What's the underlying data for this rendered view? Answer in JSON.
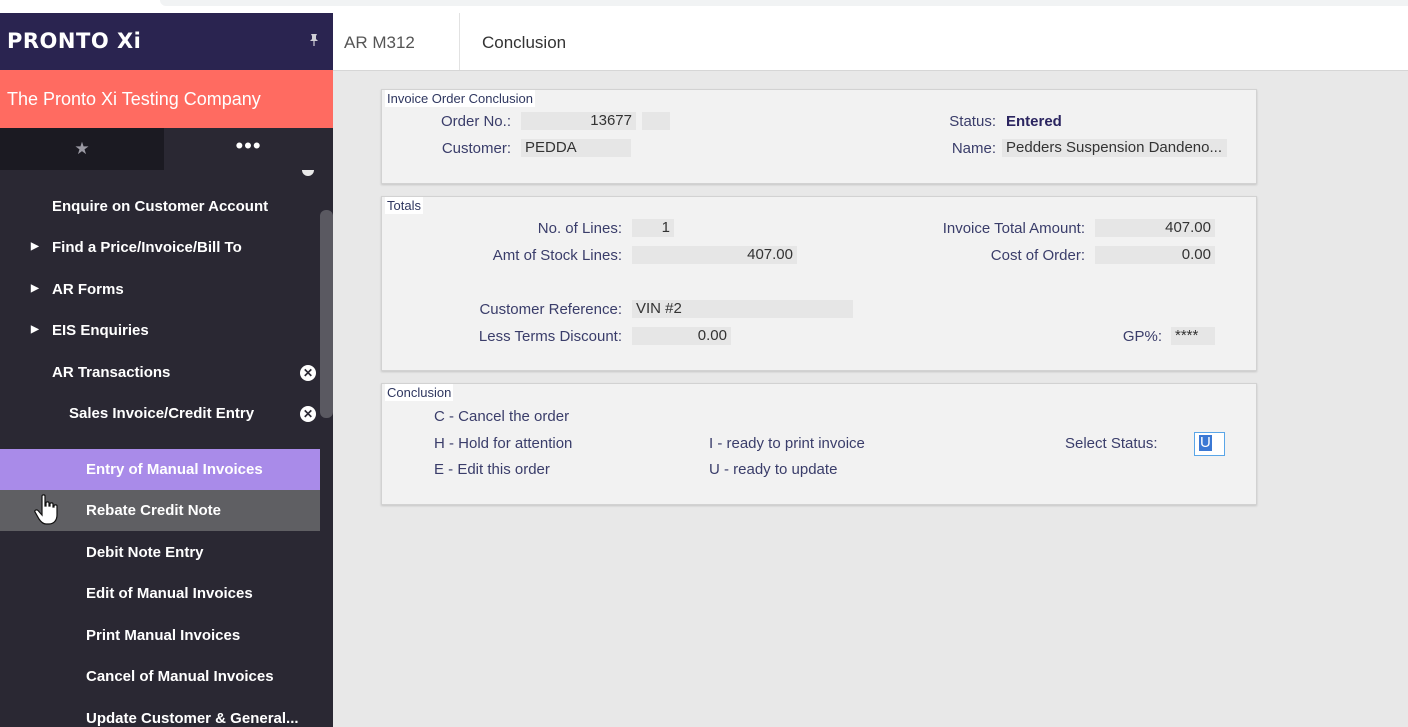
{
  "brand": {
    "logo": "PRONTO Xi",
    "pin_icon": "pin-icon"
  },
  "company": "The Pronto Xi Testing Company",
  "tabs": {
    "favorites_icon": "★",
    "more_icon": "•••"
  },
  "sidebar": {
    "items": [
      {
        "label": "Enquire on Customer Account",
        "arrow": "",
        "close": ""
      },
      {
        "label": "Find a Price/Invoice/Bill To",
        "arrow": "▶",
        "close": ""
      },
      {
        "label": "AR Forms",
        "arrow": "▶",
        "close": ""
      },
      {
        "label": "EIS Enquiries",
        "arrow": "▶",
        "close": ""
      },
      {
        "label": "AR Transactions",
        "arrow": "",
        "close": "✕"
      },
      {
        "label": "Sales Invoice/Credit Entry",
        "arrow": "",
        "close": "✕"
      },
      {
        "label": "Entry of Manual Invoices",
        "arrow": "",
        "close": ""
      },
      {
        "label": "Rebate Credit Note",
        "arrow": "",
        "close": ""
      },
      {
        "label": "Debit Note Entry",
        "arrow": "",
        "close": ""
      },
      {
        "label": "Edit of Manual Invoices",
        "arrow": "",
        "close": ""
      },
      {
        "label": "Print Manual Invoices",
        "arrow": "",
        "close": ""
      },
      {
        "label": "Cancel of Manual Invoices",
        "arrow": "",
        "close": ""
      },
      {
        "label": "Update Customer & General...",
        "arrow": "",
        "close": ""
      }
    ]
  },
  "header": {
    "code": "AR M312",
    "title": "Conclusion"
  },
  "order_panel": {
    "legend": "Invoice Order Conclusion",
    "order_no_label": "Order No.:",
    "order_no": "13677",
    "order_suffix": "",
    "customer_label": "Customer:",
    "customer": "PEDDA",
    "status_label": "Status:",
    "status": "Entered",
    "name_label": "Name:",
    "name": "Pedders Suspension Dandeno..."
  },
  "totals_panel": {
    "legend": "Totals",
    "no_lines_label": "No. of Lines:",
    "no_lines": "1",
    "amt_stock_label": "Amt of Stock Lines:",
    "amt_stock": "407.00",
    "cust_ref_label": "Customer Reference:",
    "cust_ref": "VIN #2",
    "less_terms_label": "Less Terms Discount:",
    "less_terms": "0.00",
    "invoice_total_label": "Invoice Total Amount:",
    "invoice_total": "407.00",
    "cost_label": "Cost of Order:",
    "cost": "0.00",
    "gp_label": "GP%:",
    "gp": "****"
  },
  "conclusion_panel": {
    "legend": "Conclusion",
    "opt_c": "C  - Cancel the order",
    "opt_h": "H  - Hold for attention",
    "opt_e": "E  - Edit this order",
    "opt_i": "I  - ready to print invoice",
    "opt_u": "U  - ready to update",
    "select_label": "Select Status:",
    "select_value": "U"
  }
}
